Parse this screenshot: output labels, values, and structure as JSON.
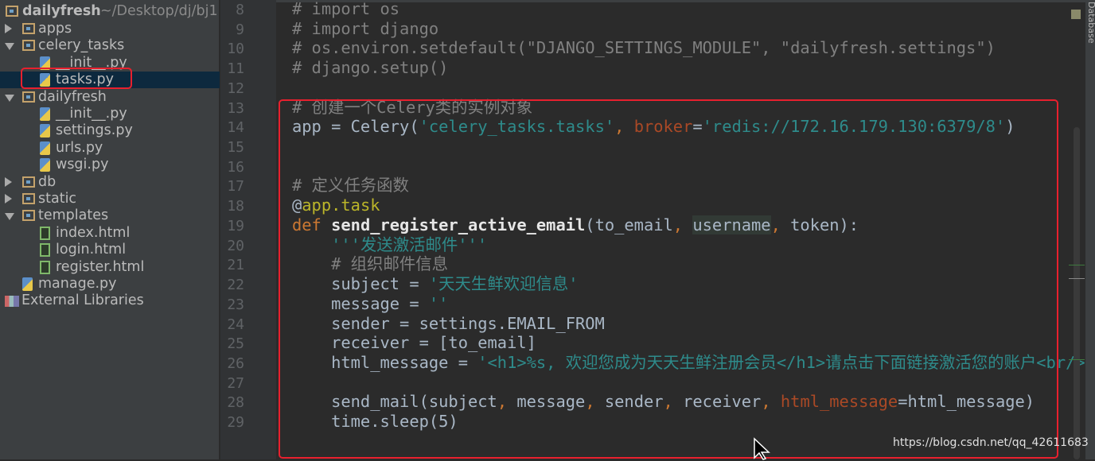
{
  "project_tree": {
    "root": {
      "name": "dailyfresh",
      "path": "~/Desktop/dj/bj1"
    },
    "items": [
      {
        "label": "apps",
        "type": "folder",
        "state": "collapsed",
        "depth": 1
      },
      {
        "label": "celery_tasks",
        "type": "folder",
        "state": "expanded",
        "depth": 1
      },
      {
        "label": "__init__.py",
        "type": "python",
        "depth": 2
      },
      {
        "label": "tasks.py",
        "type": "python",
        "depth": 2,
        "selected": true
      },
      {
        "label": "dailyfresh",
        "type": "folder",
        "state": "expanded",
        "depth": 1
      },
      {
        "label": "__init__.py",
        "type": "python",
        "depth": 2
      },
      {
        "label": "settings.py",
        "type": "python",
        "depth": 2
      },
      {
        "label": "urls.py",
        "type": "python",
        "depth": 2
      },
      {
        "label": "wsgi.py",
        "type": "python",
        "depth": 2
      },
      {
        "label": "db",
        "type": "folder",
        "state": "collapsed",
        "depth": 1
      },
      {
        "label": "static",
        "type": "folder",
        "state": "collapsed",
        "depth": 1
      },
      {
        "label": "templates",
        "type": "folder",
        "state": "expanded",
        "depth": 1
      },
      {
        "label": "index.html",
        "type": "html",
        "depth": 2
      },
      {
        "label": "login.html",
        "type": "html",
        "depth": 2
      },
      {
        "label": "register.html",
        "type": "html",
        "depth": 2
      },
      {
        "label": "manage.py",
        "type": "python",
        "depth": 1
      },
      {
        "label": "External Libraries",
        "type": "library",
        "depth": 0
      }
    ]
  },
  "editor": {
    "first_line": 8,
    "lines": [
      [
        [
          "cm",
          "# import os"
        ]
      ],
      [
        [
          "cm",
          "# import django"
        ]
      ],
      [
        [
          "cm",
          "# os.environ.setdefault(\"DJANGO_SETTINGS_MODULE\", \"dailyfresh.settings\")"
        ]
      ],
      [
        [
          "cm",
          "# django.setup()"
        ]
      ],
      [],
      [
        [
          "cm",
          "# 创建一个Celery类的实例对象"
        ]
      ],
      [
        [
          "",
          "app = Celery("
        ],
        [
          "st",
          "'celery_tasks.tasks'"
        ],
        [
          "pn",
          ", "
        ],
        [
          "ka",
          "broker"
        ],
        [
          "",
          "="
        ],
        [
          "st",
          "'redis://172.16.179.130:6379/8'"
        ],
        [
          "",
          ")"
        ]
      ],
      [],
      [],
      [
        [
          "cm",
          "# 定义任务函数"
        ]
      ],
      [
        [
          "",
          "@"
        ],
        [
          "dc",
          "app.task"
        ]
      ],
      [
        [
          "kw",
          "def "
        ],
        [
          "fn",
          "send_register_active_email"
        ],
        [
          "",
          "(to_email"
        ],
        [
          "pn",
          ", "
        ],
        [
          "hl",
          "username"
        ],
        [
          "pn",
          ", "
        ],
        [
          "",
          "token):"
        ]
      ],
      [
        [
          "",
          "    "
        ],
        [
          "st",
          "'''发送激活邮件'''"
        ]
      ],
      [
        [
          "",
          "    "
        ],
        [
          "cm",
          "# 组织邮件信息"
        ]
      ],
      [
        [
          "",
          "    subject = "
        ],
        [
          "st",
          "'天天生鲜欢迎信息'"
        ]
      ],
      [
        [
          "",
          "    message = "
        ],
        [
          "st",
          "''"
        ]
      ],
      [
        [
          "",
          "    sender = settings.EMAIL_FROM"
        ]
      ],
      [
        [
          "",
          "    receiver = [to_email]"
        ]
      ],
      [
        [
          "",
          "    html_message = "
        ],
        [
          "st",
          "'<h1>%s, 欢迎您成为天天生鲜注册会员</h1>请点击下面链接激活您的账户<br/>"
        ]
      ],
      [],
      [
        [
          "",
          "    send_mail(subject"
        ],
        [
          "pn",
          ", "
        ],
        [
          "",
          "message"
        ],
        [
          "pn",
          ", "
        ],
        [
          "",
          "sender"
        ],
        [
          "pn",
          ", "
        ],
        [
          "",
          "receiver"
        ],
        [
          "pn",
          ", "
        ],
        [
          "ka",
          "html_message"
        ],
        [
          "",
          "=html_message)"
        ]
      ],
      [
        [
          "",
          "    time.sleep(5)"
        ]
      ]
    ]
  },
  "right_panel": {
    "tab_label": "Database"
  },
  "watermark": "https://blog.csdn.net/qq_42611683",
  "colors": {
    "highlight_box": "#e8202e",
    "selection": "#0d293e",
    "string": "#2e8b8b",
    "keyword": "#cc7832"
  }
}
